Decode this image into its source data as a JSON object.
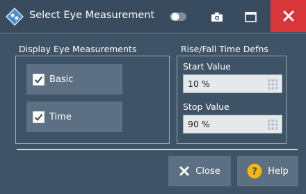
{
  "window": {
    "title": "Select Eye Measurement",
    "icons": {
      "logo": "rohde-schwarz-logo-icon",
      "toggle": "toggle-switch-icon",
      "camera": "camera-icon",
      "maximize": "maximize-icon",
      "close": "close-x-icon"
    },
    "colors": {
      "background": "#3f5366",
      "button": "#5c6f83",
      "close_accent": "#d9363a",
      "help_accent": "#f2b90f"
    }
  },
  "display_group": {
    "title": "Display Eye Measurements",
    "options": [
      {
        "label": "Basic",
        "checked": true
      },
      {
        "label": "Time",
        "checked": true
      }
    ]
  },
  "rise_fall_group": {
    "title": "Rise/Fall Time Defns",
    "start": {
      "label": "Start Value",
      "value": "10 %"
    },
    "stop": {
      "label": "Stop Value",
      "value": "90 %"
    }
  },
  "footer": {
    "close_label": "Close",
    "help_label": "Help"
  }
}
